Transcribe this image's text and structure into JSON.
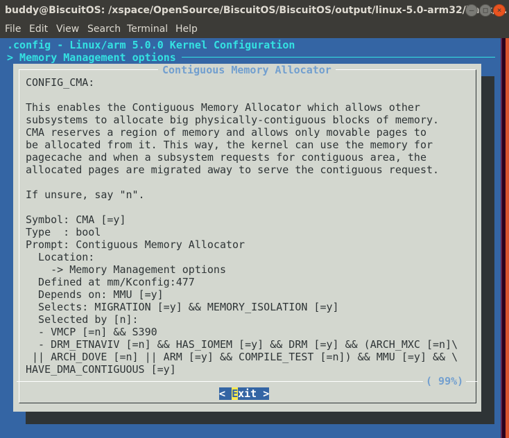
{
  "window": {
    "title": "buddy@BiscuitOS: /xspace/OpenSource/BiscuitOS/BiscuitOS/output/linux-5.0-arm32/linux/...",
    "controls": [
      "minimize",
      "maximize",
      "close"
    ]
  },
  "menu": [
    "File",
    "Edit",
    "View",
    "Search",
    "Terminal",
    "Help"
  ],
  "header": {
    "config_title": ".config - Linux/arm 5.0.0 Kernel Configuration",
    "breadcrumb": "> Memory Management options"
  },
  "dialog": {
    "title": "Contiguous Memory Allocator",
    "lines": [
      "CONFIG_CMA:",
      "",
      "This enables the Contiguous Memory Allocator which allows other",
      "subsystems to allocate big physically-contiguous blocks of memory.",
      "CMA reserves a region of memory and allows only movable pages to",
      "be allocated from it. This way, the kernel can use the memory for",
      "pagecache and when a subsystem requests for contiguous area, the",
      "allocated pages are migrated away to serve the contiguous request.",
      "",
      "If unsure, say \"n\".",
      "",
      "Symbol: CMA [=y]",
      "Type  : bool",
      "Prompt: Contiguous Memory Allocator",
      "  Location:",
      "    -> Memory Management options",
      "  Defined at mm/Kconfig:477",
      "  Depends on: MMU [=y]",
      "  Selects: MIGRATION [=y] && MEMORY_ISOLATION [=y]",
      "  Selected by [n]:",
      "  - VMCP [=n] && S390",
      "  - DRM_ETNAVIV [=n] && HAS_IOMEM [=y] && DRM [=y] && (ARCH_MXC [=n]\\",
      " || ARCH_DOVE [=n] || ARM [=y] && COMPILE_TEST [=n]) && MMU [=y] && \\",
      "HAVE_DMA_CONTIGUOUS [=y]"
    ],
    "scroll_percent": "( 99%)",
    "exit_button": {
      "left": "< ",
      "hotkey": "E",
      "rest": "xit >"
    }
  }
}
